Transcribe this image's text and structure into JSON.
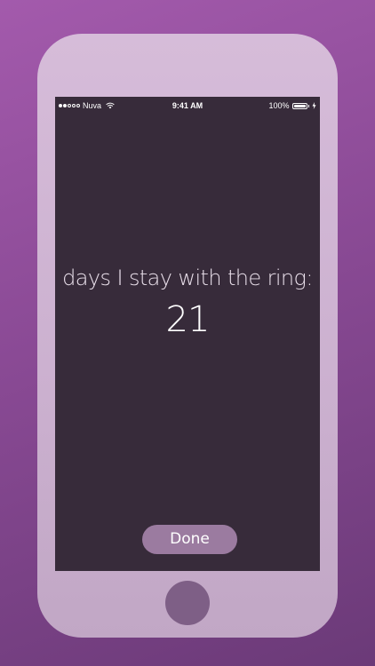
{
  "status_bar": {
    "carrier": "Nuva",
    "time": "9:41 AM",
    "battery_percent": "100%",
    "signal_bars_filled": 2,
    "signal_bars_total": 5
  },
  "main": {
    "label": "days I stay with the ring:",
    "value": "21"
  },
  "actions": {
    "done_label": "Done"
  },
  "colors": {
    "background": "#8a4a95",
    "phone_frame": "#cbb0cf",
    "screen": "#372b3a",
    "button": "#9b7ba0",
    "home_button": "#7e5f86"
  }
}
